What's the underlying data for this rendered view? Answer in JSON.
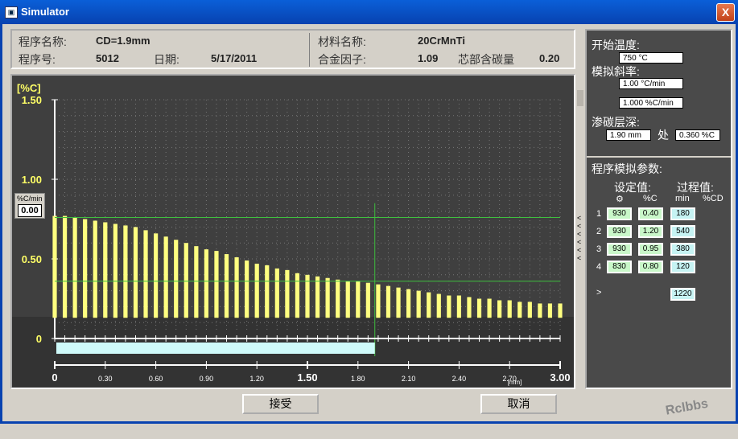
{
  "window": {
    "title": "Simulator",
    "close": "X"
  },
  "info": {
    "prog_name_label": "程序名称:",
    "prog_name": "CD=1.9mm",
    "prog_no_label": "程序号:",
    "prog_no": "5012",
    "date_label": "日期:",
    "date": "5/17/2011",
    "mat_label": "材料名称:",
    "mat": "20CrMnTi",
    "alloy_label": "合金因子:",
    "alloy": "1.09",
    "core_label": "芯部含碳量",
    "core": "0.20"
  },
  "rate": {
    "label": "%C/min",
    "value": "0.00"
  },
  "side": {
    "start_temp_label": "开始温度:",
    "start_temp": "750 °C",
    "slope_label": "模拟斜率:",
    "slope1": "1.00 °C/min",
    "slope2": "1.000 %C/min",
    "depth_label": "渗碳层深:",
    "depth": "1.90 mm",
    "at": "处",
    "depth_c": "0.360 %C",
    "params_label": "程序模拟参数:",
    "set_label": "设定值:",
    "proc_label": "过程值:",
    "col_temp": "⚙",
    "col_c": "%C",
    "col_min": "min",
    "col_pc": "%CD",
    "rows": [
      {
        "n": "1",
        "t": "930",
        "c": "0.40",
        "m": "180"
      },
      {
        "n": "2",
        "t": "930",
        "c": "1.20",
        "m": "540"
      },
      {
        "n": "3",
        "t": "930",
        "c": "0.95",
        "m": "380"
      },
      {
        "n": "4",
        "t": "830",
        "c": "0.80",
        "m": "120"
      }
    ],
    "total_sym": ">",
    "total": "1220"
  },
  "buttons": {
    "accept": "接受",
    "cancel": "取消"
  },
  "watermark": "Rclbbs",
  "chart_data": {
    "type": "bar",
    "ylabel": "[%C]",
    "xlabel": "[mm]",
    "ylim": [
      0,
      1.5
    ],
    "xlim": [
      0,
      3.0
    ],
    "yticks": [
      "0",
      "0.50",
      "1.00",
      "1.50"
    ],
    "xticks": [
      "0",
      "0.30",
      "0.60",
      "0.90",
      "1.20",
      "1.50",
      "1.80",
      "2.10",
      "2.40",
      "2.70",
      "3.00"
    ],
    "case_depth_mm": 1.9,
    "ref_lines_c": [
      0.76,
      0.36
    ],
    "x": [
      0.0,
      0.06,
      0.12,
      0.18,
      0.24,
      0.3,
      0.36,
      0.42,
      0.48,
      0.54,
      0.6,
      0.66,
      0.72,
      0.78,
      0.84,
      0.9,
      0.96,
      1.02,
      1.08,
      1.14,
      1.2,
      1.26,
      1.32,
      1.38,
      1.44,
      1.5,
      1.56,
      1.62,
      1.68,
      1.74,
      1.8,
      1.86,
      1.92,
      1.98,
      2.04,
      2.1,
      2.16,
      2.22,
      2.28,
      2.34,
      2.4,
      2.46,
      2.52,
      2.58,
      2.64,
      2.7,
      2.76,
      2.82,
      2.88,
      2.94,
      3.0
    ],
    "values": [
      0.77,
      0.77,
      0.76,
      0.75,
      0.74,
      0.73,
      0.72,
      0.71,
      0.7,
      0.68,
      0.66,
      0.64,
      0.62,
      0.6,
      0.58,
      0.56,
      0.55,
      0.53,
      0.51,
      0.49,
      0.47,
      0.46,
      0.44,
      0.43,
      0.41,
      0.4,
      0.39,
      0.38,
      0.37,
      0.36,
      0.36,
      0.35,
      0.34,
      0.33,
      0.32,
      0.31,
      0.3,
      0.29,
      0.28,
      0.27,
      0.27,
      0.26,
      0.25,
      0.25,
      0.24,
      0.24,
      0.23,
      0.23,
      0.22,
      0.22,
      0.22
    ]
  }
}
